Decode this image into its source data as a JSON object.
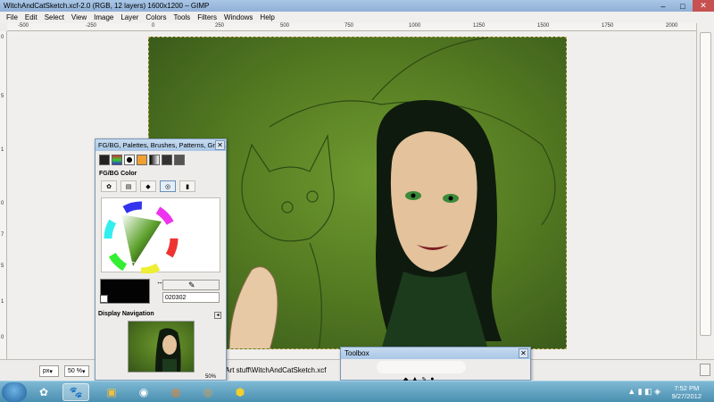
{
  "window": {
    "title": "WitchAndCatSketch.xcf-2.0 (RGB, 12 layers) 1600x1200 – GIMP",
    "minimize": "–",
    "maximize": "□",
    "close": "✕"
  },
  "menu": [
    "File",
    "Edit",
    "Select",
    "View",
    "Image",
    "Layer",
    "Colors",
    "Tools",
    "Filters",
    "Windows",
    "Help"
  ],
  "ruler_h": [
    "-500",
    "-250",
    "0",
    "250",
    "500",
    "750",
    "1000",
    "1250",
    "1500",
    "1750",
    "2000"
  ],
  "ruler_v": [
    "0",
    "5",
    "1",
    "0",
    "7",
    "5",
    "1",
    "0"
  ],
  "dock": {
    "title": "FG/BG, Palettes, Brushes, Patterns, Gradi...",
    "section_label": "FG/BG Color",
    "hex_value": "020302",
    "nav_label": "Display Navigation",
    "nav_zoom": "50%"
  },
  "statusbar": {
    "unit": "px",
    "zoom": "50 %",
    "message": "\\Art stuff\\WitchAndCatSketch.xcf"
  },
  "toolbox": {
    "title": "Toolbox"
  },
  "taskbar": {
    "time": "7:52 PM",
    "date": "9/27/2012"
  },
  "colors": {
    "foreground": "#020302",
    "background": "#ffffff",
    "artwork_green": "#567d22"
  }
}
